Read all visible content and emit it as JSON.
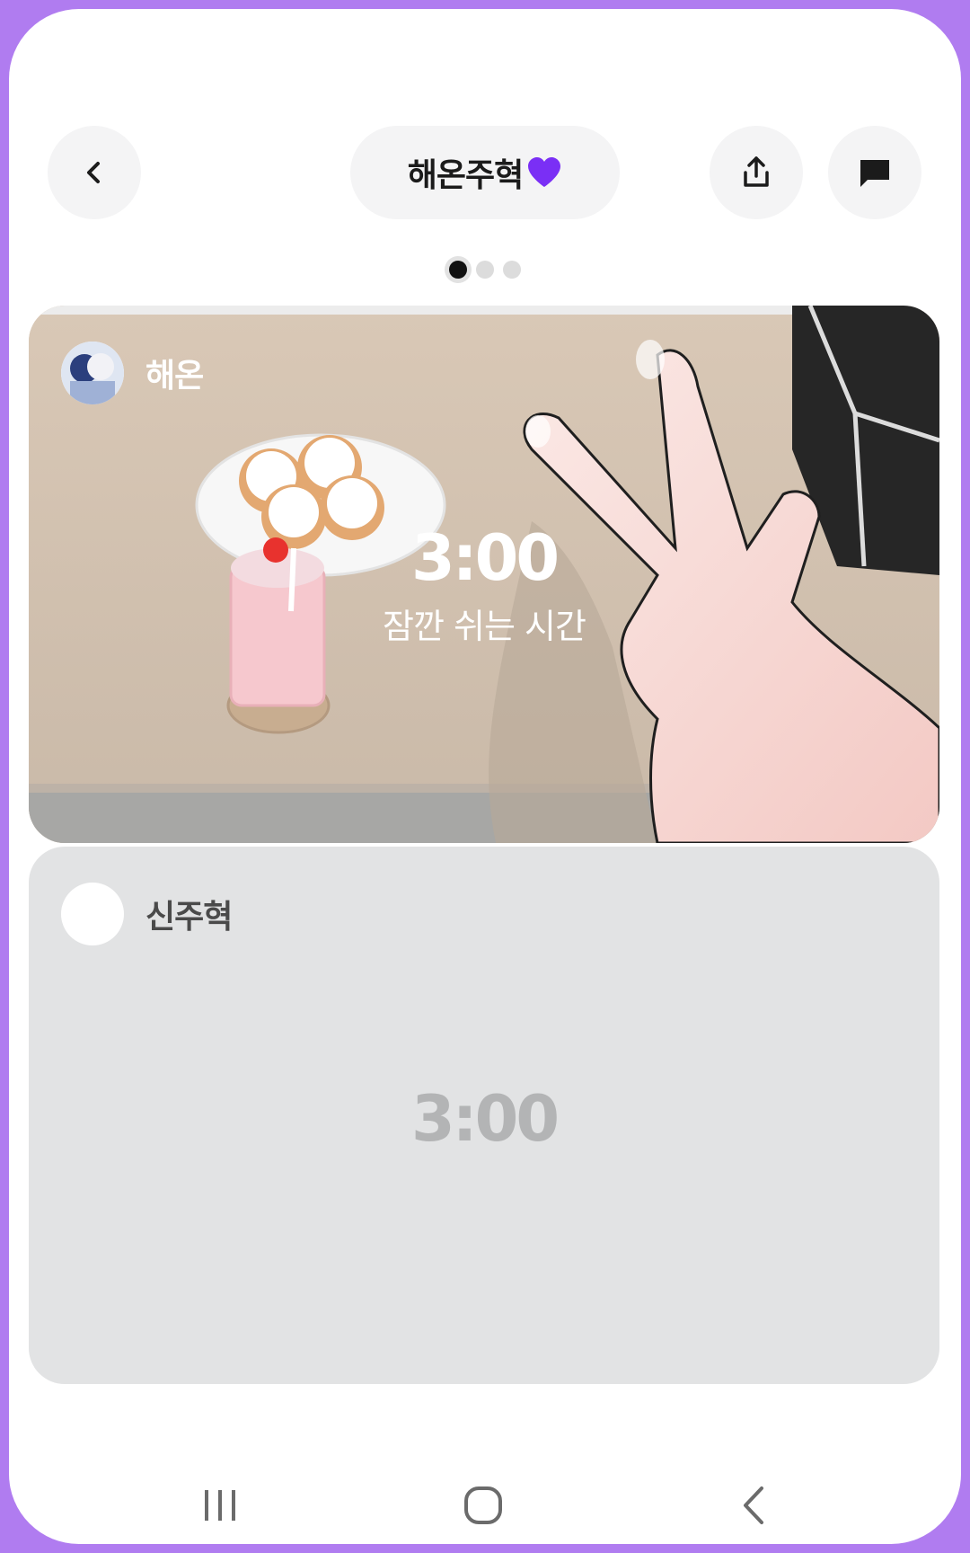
{
  "header": {
    "title": "해온주혁",
    "heart_color": "#7a2ff5"
  },
  "pager": {
    "count": 3,
    "active_index": 0
  },
  "cards": [
    {
      "name": "해온",
      "timer": "3:00",
      "subtitle": "잠깐 쉬는 시간"
    },
    {
      "name": "신주혁",
      "timer": "3:00"
    }
  ],
  "icons": {
    "back": "chevron-left-icon",
    "share": "share-icon",
    "chat": "chat-bubble-icon",
    "nav_recents": "recents-icon",
    "nav_home": "home-icon",
    "nav_back": "back-icon"
  }
}
